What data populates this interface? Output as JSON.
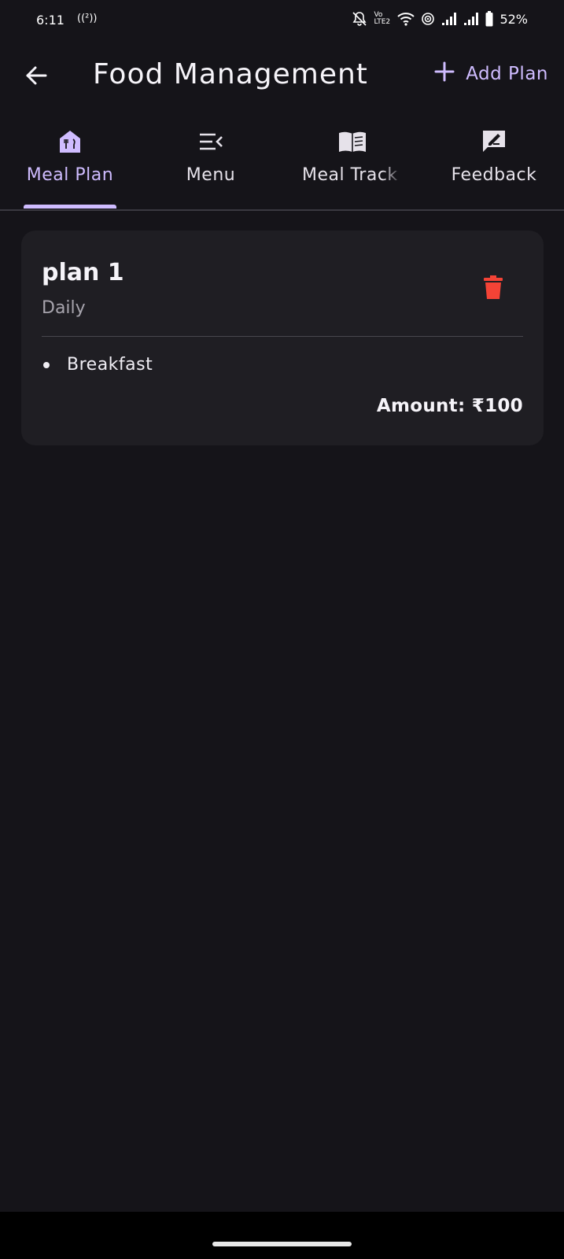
{
  "status_bar": {
    "time": "6:11",
    "hotspot_label": "((²))",
    "network_label": "Vo LTE2",
    "battery_percent": "52%"
  },
  "app_bar": {
    "back_icon": "arrow-left-icon",
    "title": "Food Management",
    "add_plan_label": "Add Plan",
    "add_icon": "plus-icon"
  },
  "tabs": [
    {
      "label": "Meal Plan",
      "icon": "restaurant-house-icon",
      "active": true
    },
    {
      "label": "Menu",
      "icon": "menu-open-icon",
      "active": false
    },
    {
      "label": "Meal Track",
      "icon": "book-open-icon",
      "active": false
    },
    {
      "label": "Feedback",
      "icon": "feedback-icon",
      "active": false
    }
  ],
  "plans": [
    {
      "name": "plan 1",
      "frequency": "Daily",
      "meals": [
        "Breakfast"
      ],
      "amount_text": "Amount: ₹100",
      "delete_icon": "trash-icon"
    }
  ],
  "colors": {
    "background": "#151419",
    "card": "#1f1e23",
    "accent": "#cfbcff",
    "delete": "#f44336"
  }
}
